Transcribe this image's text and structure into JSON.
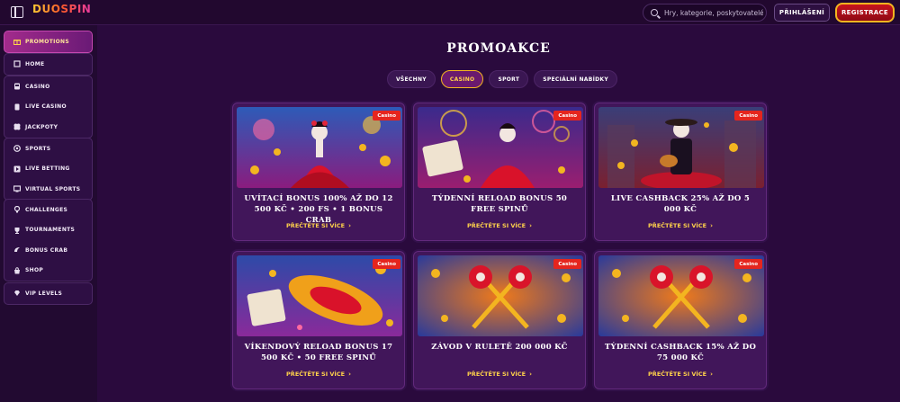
{
  "header": {
    "logo_text": "DUOSPIN",
    "search_placeholder": "Hry, kategorie, poskytovatelé",
    "login_label": "PŘIHLÁŠENÍ",
    "register_label": "REGISTRACE"
  },
  "sidebar": {
    "groups": [
      {
        "items": [
          {
            "label": "PROMOTIONS",
            "icon": "gift-icon"
          }
        ],
        "active": true
      },
      {
        "items": [
          {
            "label": "HOME",
            "icon": "home-icon"
          }
        ]
      },
      {
        "items": [
          {
            "label": "CASINO",
            "icon": "slot-icon"
          },
          {
            "label": "LIVE CASINO",
            "icon": "cards-icon"
          },
          {
            "label": "JACKPOTY",
            "icon": "clover-icon"
          }
        ]
      },
      {
        "items": [
          {
            "label": "SPORTS",
            "icon": "ball-icon"
          },
          {
            "label": "LIVE BETTING",
            "icon": "play-icon"
          },
          {
            "label": "VIRTUAL SPORTS",
            "icon": "monitor-icon"
          }
        ]
      },
      {
        "items": [
          {
            "label": "CHALLENGES",
            "icon": "trophy-icon"
          },
          {
            "label": "TOURNAMENTS",
            "icon": "cup-icon"
          },
          {
            "label": "BONUS CRAB",
            "icon": "crab-icon"
          },
          {
            "label": "SHOP",
            "icon": "shop-icon"
          }
        ]
      },
      {
        "items": [
          {
            "label": "VIP LEVELS",
            "icon": "diamond-icon"
          }
        ]
      }
    ]
  },
  "main": {
    "title": "PROMOAKCE",
    "tabs": [
      {
        "label": "VŠECHNY",
        "active": false
      },
      {
        "label": "CASINO",
        "active": true
      },
      {
        "label": "SPORT",
        "active": false
      },
      {
        "label": "SPECIÁLNÍ NABÍDKY",
        "active": false
      }
    ],
    "cards": [
      {
        "badge": "Casino",
        "title": "UVÍTACÍ BONUS 100% AŽ DO 12 500 KČ • 200 FS • 1 BONUS CRAB",
        "link": "PŘEČTĚTE SI VÍCE"
      },
      {
        "badge": "Casino",
        "title": "TÝDENNÍ RELOAD BONUS 50 FREE SPINŮ",
        "link": "PŘEČTĚTE SI VÍCE"
      },
      {
        "badge": "Casino",
        "title": "LIVE CASHBACK 25% AŽ DO 5 000 KČ",
        "link": "PŘEČTĚTE SI VÍCE"
      },
      {
        "badge": "Casino",
        "title": "VÍKENDOVÝ RELOAD BONUS 17 500 KČ • 50 FREE SPINŮ",
        "link": "PŘEČTĚTE SI VÍCE"
      },
      {
        "badge": "Casino",
        "title": "ZÁVOD V RULETĚ 200 000 KČ",
        "link": "PŘEČTĚTE SI VÍCE"
      },
      {
        "badge": "Casino",
        "title": "TÝDENNÍ CASHBACK 15% AŽ DO 75 000 KČ",
        "link": "PŘEČTĚTE SI VÍCE"
      }
    ]
  },
  "colors": {
    "accent_gold": "#f3b520",
    "register_red": "#c8141e",
    "badge_red": "#e5251e",
    "link_yellow": "#ffd24a"
  }
}
